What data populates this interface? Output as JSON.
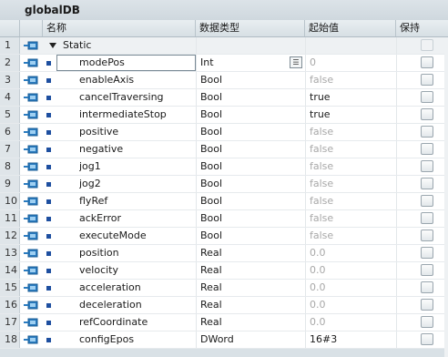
{
  "window": {
    "title": "globalDB"
  },
  "columns": {
    "name": "名称",
    "type": "数据类型",
    "start": "起始值",
    "retain": "保持"
  },
  "static": {
    "num": "1",
    "name": "Static"
  },
  "rows": [
    {
      "num": "2",
      "name": "modePos",
      "type": "Int",
      "start": "0",
      "dim": true
    },
    {
      "num": "3",
      "name": "enableAxis",
      "type": "Bool",
      "start": "false",
      "dim": true
    },
    {
      "num": "4",
      "name": "cancelTraversing",
      "type": "Bool",
      "start": "true",
      "dim": false
    },
    {
      "num": "5",
      "name": "intermediateStop",
      "type": "Bool",
      "start": "true",
      "dim": false
    },
    {
      "num": "6",
      "name": "positive",
      "type": "Bool",
      "start": "false",
      "dim": true
    },
    {
      "num": "7",
      "name": "negative",
      "type": "Bool",
      "start": "false",
      "dim": true
    },
    {
      "num": "8",
      "name": "jog1",
      "type": "Bool",
      "start": "false",
      "dim": true
    },
    {
      "num": "9",
      "name": "jog2",
      "type": "Bool",
      "start": "false",
      "dim": true
    },
    {
      "num": "10",
      "name": "flyRef",
      "type": "Bool",
      "start": "false",
      "dim": true
    },
    {
      "num": "11",
      "name": "ackError",
      "type": "Bool",
      "start": "false",
      "dim": true
    },
    {
      "num": "12",
      "name": "executeMode",
      "type": "Bool",
      "start": "false",
      "dim": true
    },
    {
      "num": "13",
      "name": "position",
      "type": "Real",
      "start": "0.0",
      "dim": true
    },
    {
      "num": "14",
      "name": "velocity",
      "type": "Real",
      "start": "0.0",
      "dim": true
    },
    {
      "num": "15",
      "name": "acceleration",
      "type": "Real",
      "start": "0.0",
      "dim": true
    },
    {
      "num": "16",
      "name": "deceleration",
      "type": "Real",
      "start": "0.0",
      "dim": true
    },
    {
      "num": "17",
      "name": "refCoordinate",
      "type": "Real",
      "start": "0.0",
      "dim": true
    },
    {
      "num": "18",
      "name": "configEpos",
      "type": "DWord",
      "start": "16#3",
      "dim": false
    }
  ],
  "editing_row": 0,
  "icons": {
    "interface": "db-interface-icon",
    "dropdown": "list-dropdown-icon",
    "expand": "collapse-arrow-icon"
  },
  "colors": {
    "accent": "#1e4fa0",
    "icon_blue": "#2a7bbf",
    "dim_text": "#a8a8a8"
  }
}
